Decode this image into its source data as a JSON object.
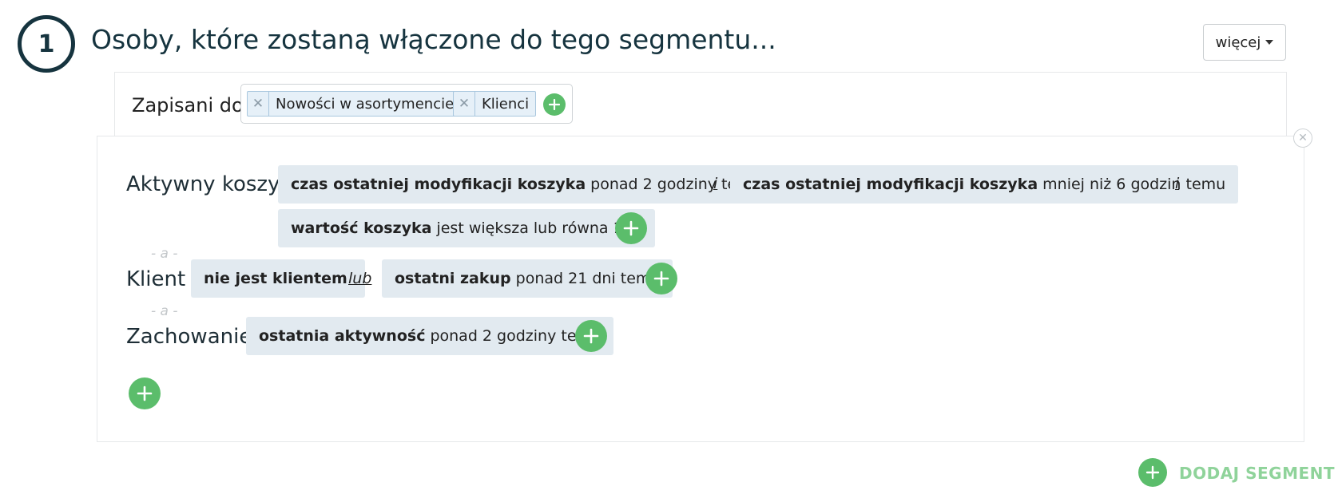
{
  "step": {
    "number": "1",
    "title": "Osoby, które zostaną włączone do tego segmentu..."
  },
  "more_button": {
    "label": "więcej"
  },
  "subscribed": {
    "label": "Zapisani do",
    "tags": [
      {
        "label": "Nowości w asortymencie"
      },
      {
        "label": "Klienci"
      }
    ]
  },
  "groups": {
    "cart": {
      "label": "Aktywny koszyk",
      "conditions": [
        {
          "field": "czas ostatniej modyfikacji koszyka",
          "rule": "ponad 2 godziny temu"
        },
        {
          "field": "czas ostatniej modyfikacji koszyka",
          "rule": "mniej niż 6 godzin temu"
        },
        {
          "field": "wartość koszyka",
          "rule": "jest większa lub równa 100"
        }
      ],
      "conjunctions": [
        "i",
        "i"
      ]
    },
    "client": {
      "label": "Klient",
      "conditions": [
        {
          "field": "nie jest klientem",
          "rule": ""
        },
        {
          "field": "ostatni zakup",
          "rule": "ponad 21 dni temu"
        }
      ],
      "conjunctions": [
        "lub"
      ]
    },
    "behavior": {
      "label": "Zachowanie",
      "conditions": [
        {
          "field": "ostatnia aktywność",
          "rule": "ponad 2 godziny temu"
        }
      ]
    }
  },
  "separators": {
    "and": "- a -"
  },
  "add_segment": {
    "label": "DODAJ SEGMENT"
  },
  "colors": {
    "accent_green": "#5bbd6b",
    "chip_bg": "#e2eaf0",
    "title": "#16343f"
  }
}
